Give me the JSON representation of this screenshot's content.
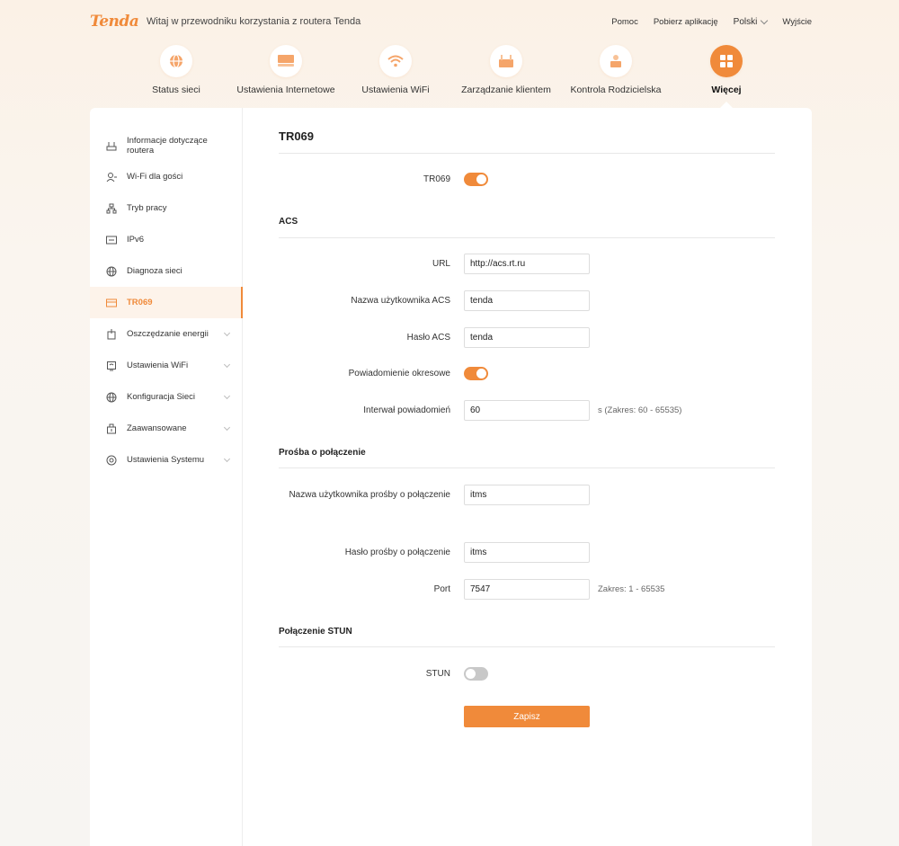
{
  "header": {
    "logo": "Tenda",
    "welcome": "Witaj w przewodniku korzystania z routera Tenda",
    "links": {
      "help": "Pomoc",
      "download": "Pobierz aplikację",
      "language": "Polski",
      "logout": "Wyjście"
    }
  },
  "nav": [
    {
      "label": "Status sieci",
      "icon": "globe-icon"
    },
    {
      "label": "Ustawienia Internetowe",
      "icon": "internet-icon"
    },
    {
      "label": "Ustawienia WiFi",
      "icon": "wifi-icon"
    },
    {
      "label": "Zarządzanie klientem",
      "icon": "client-icon"
    },
    {
      "label": "Kontrola Rodzicielska",
      "icon": "parental-icon"
    },
    {
      "label": "Więcej",
      "icon": "grid-icon",
      "active": true
    }
  ],
  "sidebar": [
    {
      "label": "Informacje dotyczące routera",
      "icon": "router-icon"
    },
    {
      "label": "Wi-Fi dla gości",
      "icon": "guest-icon"
    },
    {
      "label": "Tryb pracy",
      "icon": "mode-icon"
    },
    {
      "label": "IPv6",
      "icon": "ipv6-icon"
    },
    {
      "label": "Diagnoza sieci",
      "icon": "globe-icon"
    },
    {
      "label": "TR069",
      "icon": "tr069-icon",
      "active": true
    },
    {
      "label": "Oszczędzanie energii",
      "icon": "energy-icon",
      "expandable": true
    },
    {
      "label": "Ustawienia WiFi",
      "icon": "wifi-settings-icon",
      "expandable": true
    },
    {
      "label": "Konfiguracja Sieci",
      "icon": "globe-icon",
      "expandable": true
    },
    {
      "label": "Zaawansowane",
      "icon": "advanced-icon",
      "expandable": true
    },
    {
      "label": "Ustawienia Systemu",
      "icon": "system-icon",
      "expandable": true
    }
  ],
  "main": {
    "title": "TR069",
    "tr069": {
      "label": "TR069",
      "enabled": true
    },
    "acs": {
      "title": "ACS",
      "url": {
        "label": "URL",
        "value": "http://acs.rt.ru"
      },
      "username": {
        "label": "Nazwa użytkownika ACS",
        "value": "tenda"
      },
      "password": {
        "label": "Hasło ACS",
        "value": "tenda"
      },
      "periodic": {
        "label": "Powiadomienie okresowe",
        "enabled": true
      },
      "interval": {
        "label": "Interwał powiadomień",
        "value": "60",
        "hint": "s (Zakres: 60 - 65535)"
      }
    },
    "connection_request": {
      "title": "Prośba o połączenie",
      "username": {
        "label": "Nazwa użytkownika prośby o połączenie",
        "value": "itms"
      },
      "password": {
        "label": "Hasło prośby o połączenie",
        "value": "itms"
      },
      "port": {
        "label": "Port",
        "value": "7547",
        "hint": "Zakres: 1 - 65535"
      }
    },
    "stun": {
      "title": "Połączenie STUN",
      "label": "STUN",
      "enabled": false
    },
    "save_label": "Zapisz"
  },
  "colors": {
    "accent": "#f08a3a",
    "toggle_off": "#c8c8c8"
  }
}
